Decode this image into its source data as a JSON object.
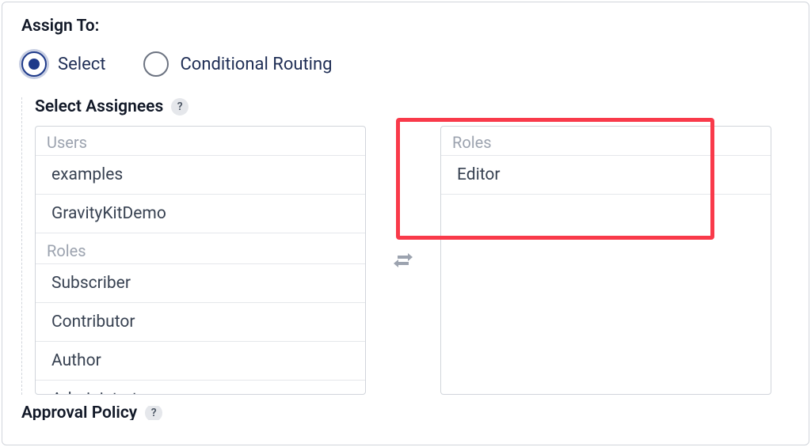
{
  "assign_to_label": "Assign To:",
  "radios": {
    "select": "Select",
    "conditional": "Conditional Routing"
  },
  "select_assignees_label": "Select Assignees",
  "help_char": "?",
  "left_list": {
    "group_users": "Users",
    "user_items": [
      "examples",
      "GravityKitDemo"
    ],
    "group_roles": "Roles",
    "role_items": [
      "Subscriber",
      "Contributor",
      "Author"
    ],
    "cut_item": "Administrator"
  },
  "right_list": {
    "group_roles": "Roles",
    "role_items": [
      "Editor"
    ]
  },
  "approval_policy_label": "Approval Policy",
  "help_char2": "?"
}
